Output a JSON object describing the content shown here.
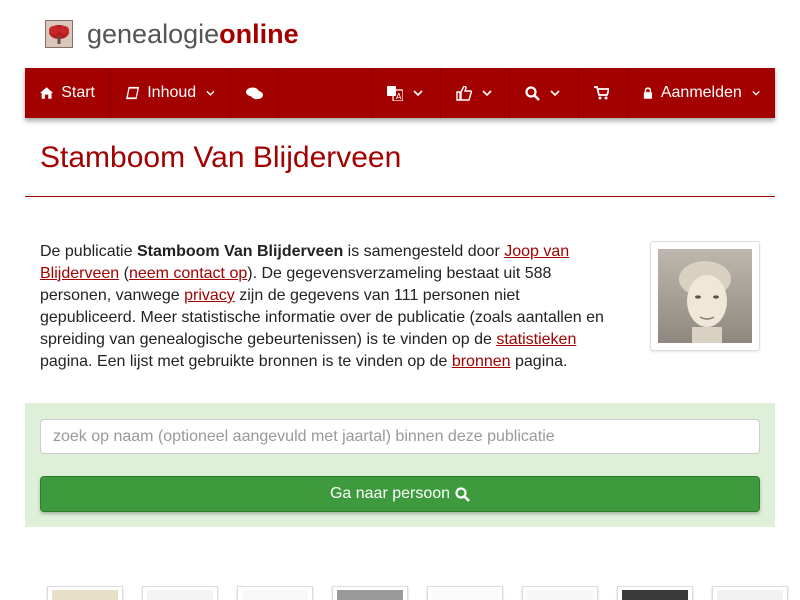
{
  "logo": {
    "part1": "genealogie",
    "part2": "online",
    "icon": "tree-icon"
  },
  "nav": {
    "start": {
      "label": "Start",
      "icon": "home-icon"
    },
    "inhoud": {
      "label": "Inhoud",
      "icon": "book-icon"
    },
    "chat": {
      "icon": "comments-icon"
    },
    "language": {
      "icon": "language-icon"
    },
    "thumb": {
      "icon": "thumbs-up-icon"
    },
    "search": {
      "icon": "search-icon"
    },
    "cart": {
      "icon": "cart-icon"
    },
    "login": {
      "label": "Aanmelden",
      "icon": "lock-icon"
    }
  },
  "page": {
    "title": "Stamboom Van Blijderveen"
  },
  "intro": {
    "t1": "De publicatie ",
    "pubname": "Stamboom Van Blijderveen",
    "t2": " is samengesteld door ",
    "author": "Joop van Blijderveen",
    "t3": " (",
    "contact": "neem contact op",
    "t4": "). De gegevensverzameling bestaat uit 588 personen, vanwege ",
    "privacy": "privacy",
    "t5": " zijn de gegevens van 111 personen niet gepubliceerd. Meer statistische informatie over de publicatie (zoals aantallen en spreiding van genealogische gebeurtenissen) is te vinden op de ",
    "stats": "statistieken",
    "t6": " pagina. Een lijst met gebruikte bronnen is te vinden op de ",
    "sources": "bronnen",
    "t7": " pagina."
  },
  "search": {
    "placeholder": "zoek op naam (optioneel aangevuld met jaartal) binnen deze publicatie",
    "button_label": "Ga naar persoon"
  },
  "colors": {
    "brand": "#a30000",
    "panel": "#dff0d8",
    "button": "#3d9a3d"
  }
}
